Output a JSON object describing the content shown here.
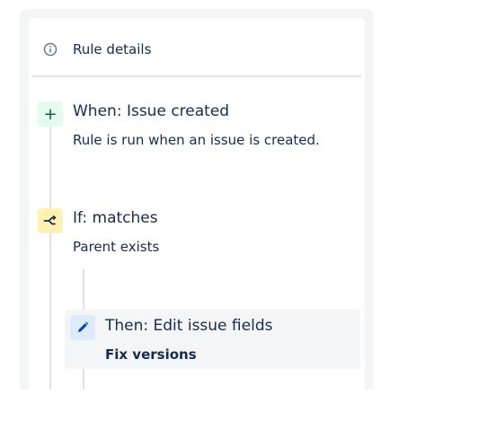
{
  "header": {
    "title": "Rule details",
    "icon": "info-icon"
  },
  "steps": [
    {
      "kind": "trigger",
      "icon": "plus-icon",
      "icon_glyph": "+",
      "title": "When: Issue created",
      "description": "Rule is run when an issue is created.",
      "accent": "#006644"
    },
    {
      "kind": "condition",
      "icon": "branch-icon",
      "title": "If: matches",
      "description": "Parent exists",
      "accent": "#ff8b00"
    },
    {
      "kind": "action",
      "icon": "pencil-icon",
      "title": "Then: Edit issue fields",
      "description": "Fix versions",
      "accent": "#0052cc"
    }
  ]
}
